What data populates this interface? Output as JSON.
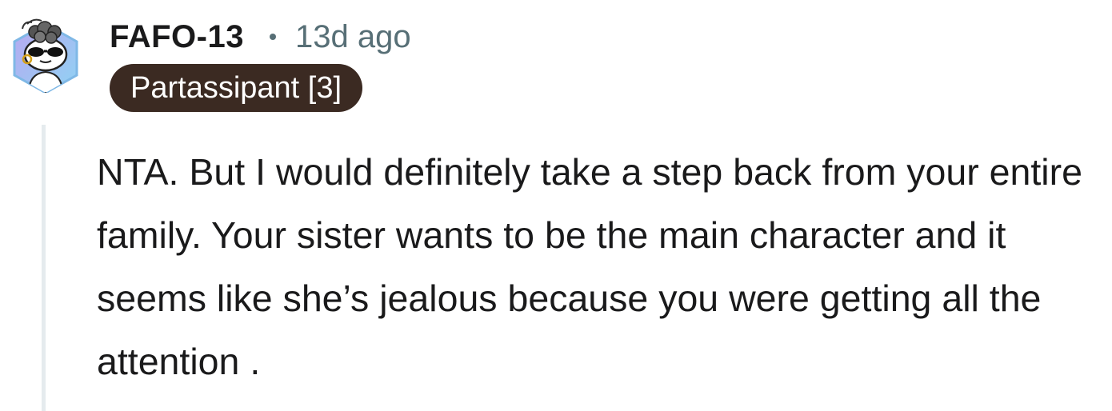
{
  "comment": {
    "author": {
      "username": "FAFO-13",
      "avatar_icon": "snoo-avatar-icon",
      "flair": "Partassipant [3]",
      "flair_color": "#3b2a22"
    },
    "timestamp": "13d ago",
    "separator_icon": "dot-separator-icon",
    "body": "NTA. But I would definitely take a step back from your entire family. Your sister wants to be the main character and it seems like she’s jealous because you were getting all the attention ."
  },
  "colors": {
    "text_primary": "#1a1a1b",
    "text_meta": "#576f76",
    "thread_line": "#e5ebee",
    "avatar_hex": "#7fb8e6"
  }
}
